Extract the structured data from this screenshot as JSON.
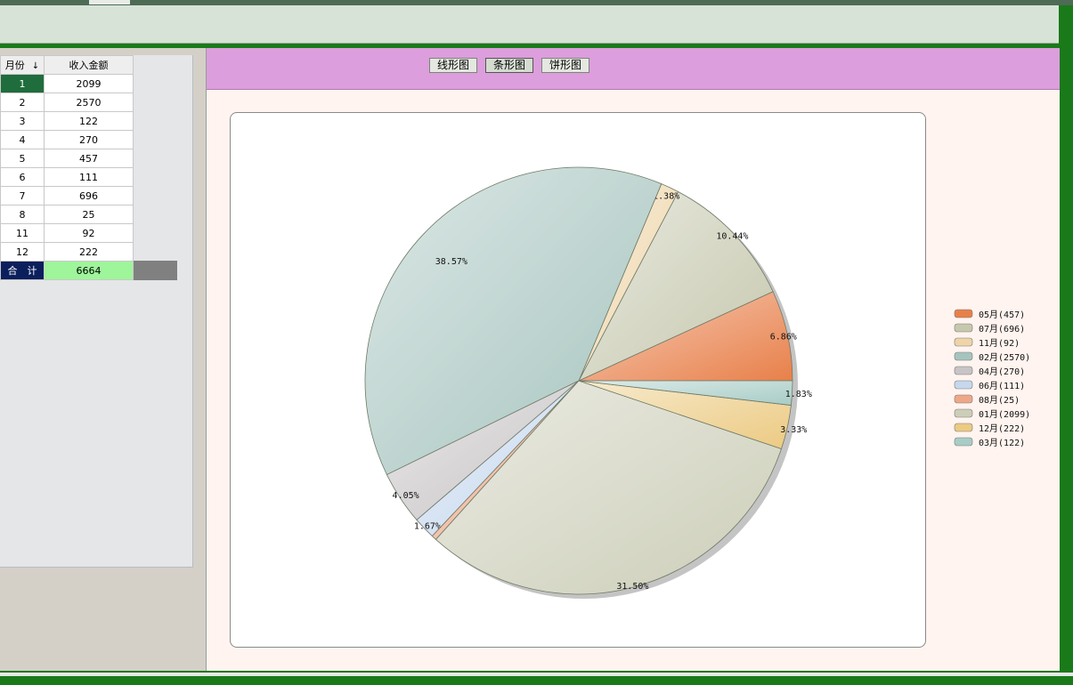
{
  "grid": {
    "headers": {
      "month": "月份",
      "amount": "收入金额",
      "sort_icon": "↓"
    },
    "rows": [
      {
        "month": "1",
        "amount": "2099"
      },
      {
        "month": "2",
        "amount": "2570"
      },
      {
        "month": "3",
        "amount": "122"
      },
      {
        "month": "4",
        "amount": "270"
      },
      {
        "month": "5",
        "amount": "457"
      },
      {
        "month": "6",
        "amount": "111"
      },
      {
        "month": "7",
        "amount": "696"
      },
      {
        "month": "8",
        "amount": "25"
      },
      {
        "month": "11",
        "amount": "92"
      },
      {
        "month": "12",
        "amount": "222"
      }
    ],
    "total": {
      "label": "合　计",
      "amount": "6664"
    }
  },
  "toolbar": {
    "line_label": "线形图",
    "bar_label": "条形图",
    "pie_label": "饼形图"
  },
  "chart_data": {
    "type": "pie",
    "legend_position": "right",
    "slices": [
      {
        "label": "05月(457)",
        "value": 457,
        "pct_label": "6.86%",
        "color": "#e8804a"
      },
      {
        "label": "07月(696)",
        "value": 696,
        "pct_label": "10.44%",
        "color": "#c6c8ae"
      },
      {
        "label": "11月(92)",
        "value": 92,
        "pct_label": "1.38%",
        "color": "#eed4a8"
      },
      {
        "label": "02月(2570)",
        "value": 2570,
        "pct_label": "38.57%",
        "color": "#a6c4be"
      },
      {
        "label": "04月(270)",
        "value": 270,
        "pct_label": "4.05%",
        "color": "#c8c4c6"
      },
      {
        "label": "06月(111)",
        "value": 111,
        "pct_label": "1.67%",
        "color": "#c6d8ee"
      },
      {
        "label": "08月(25)",
        "value": 25,
        "pct_label": "",
        "color": "#eea888"
      },
      {
        "label": "01月(2099)",
        "value": 2099,
        "pct_label": "31.50%",
        "color": "#ccceb8"
      },
      {
        "label": "12月(222)",
        "value": 222,
        "pct_label": "3.33%",
        "color": "#ecca82"
      },
      {
        "label": "03月(122)",
        "value": 122,
        "pct_label": "1.83%",
        "color": "#a8ccc6"
      }
    ]
  }
}
